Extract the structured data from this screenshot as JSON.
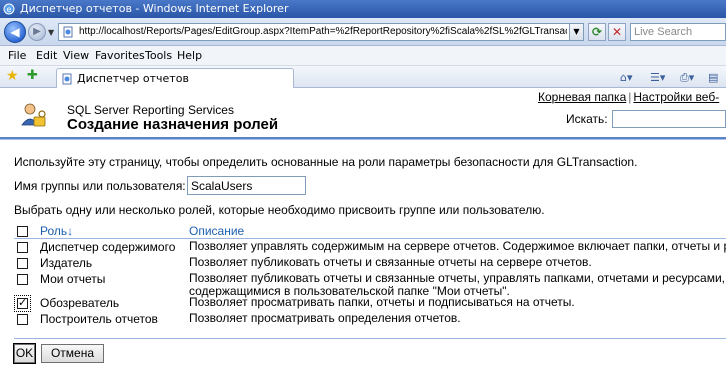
{
  "window": {
    "title": "Диспетчер отчетов - Windows Internet Explorer"
  },
  "browser": {
    "url": "http://localhost/Reports/Pages/EditGroup.aspx?ItemPath=%2fReportRepository%2fiScala%2fSL%2fGLTransaction&Redirect",
    "search_placeholder": "Live Search",
    "menu": [
      "File",
      "Edit",
      "View",
      "Favorites",
      "Tools",
      "Help"
    ],
    "tab_label": "Диспетчер отчетов"
  },
  "header": {
    "product": "SQL Server Reporting Services",
    "title": "Создание назначения ролей",
    "link_home": "Корневая папка",
    "link_sep": "|",
    "link_settings": "Настройки веб-",
    "search_label": "Искать:"
  },
  "form": {
    "description": "Используйте эту страницу, чтобы определить основанные на роли параметры безопасности для GLTransaction.",
    "group_label": "Имя группы или пользователя:",
    "group_value": "ScalaUsers",
    "choose_text": "Выбрать одну или несколько ролей, которые необходимо присвоить группе или пользователю."
  },
  "table": {
    "col_role": "Роль↓",
    "col_desc": "Описание",
    "rows": [
      {
        "role": "Диспетчер содержимого",
        "desc": "Позволяет управлять содержимым на сервере отчетов. Содержимое включает папки, отчеты и р",
        "desc2": "",
        "checked": false
      },
      {
        "role": "Издатель",
        "desc": "Позволяет публиковать отчеты и связанные отчеты на сервере отчетов.",
        "desc2": "",
        "checked": false
      },
      {
        "role": "Мои отчеты",
        "desc": "Позволяет публиковать отчеты и связанные отчеты, управлять папками, отчетами и ресурсами,",
        "desc2": "содержащимися в пользовательской папке \"Мои отчеты\".",
        "checked": false
      },
      {
        "role": "Обозреватель",
        "desc": "Позволяет просматривать папки, отчеты и подписываться на отчеты.",
        "desc2": "",
        "checked": true
      },
      {
        "role": "Построитель отчетов",
        "desc": "Позволяет просматривать определения отчетов.",
        "desc2": "",
        "checked": false
      }
    ]
  },
  "buttons": {
    "ok": "OK",
    "cancel": "Отмена"
  }
}
